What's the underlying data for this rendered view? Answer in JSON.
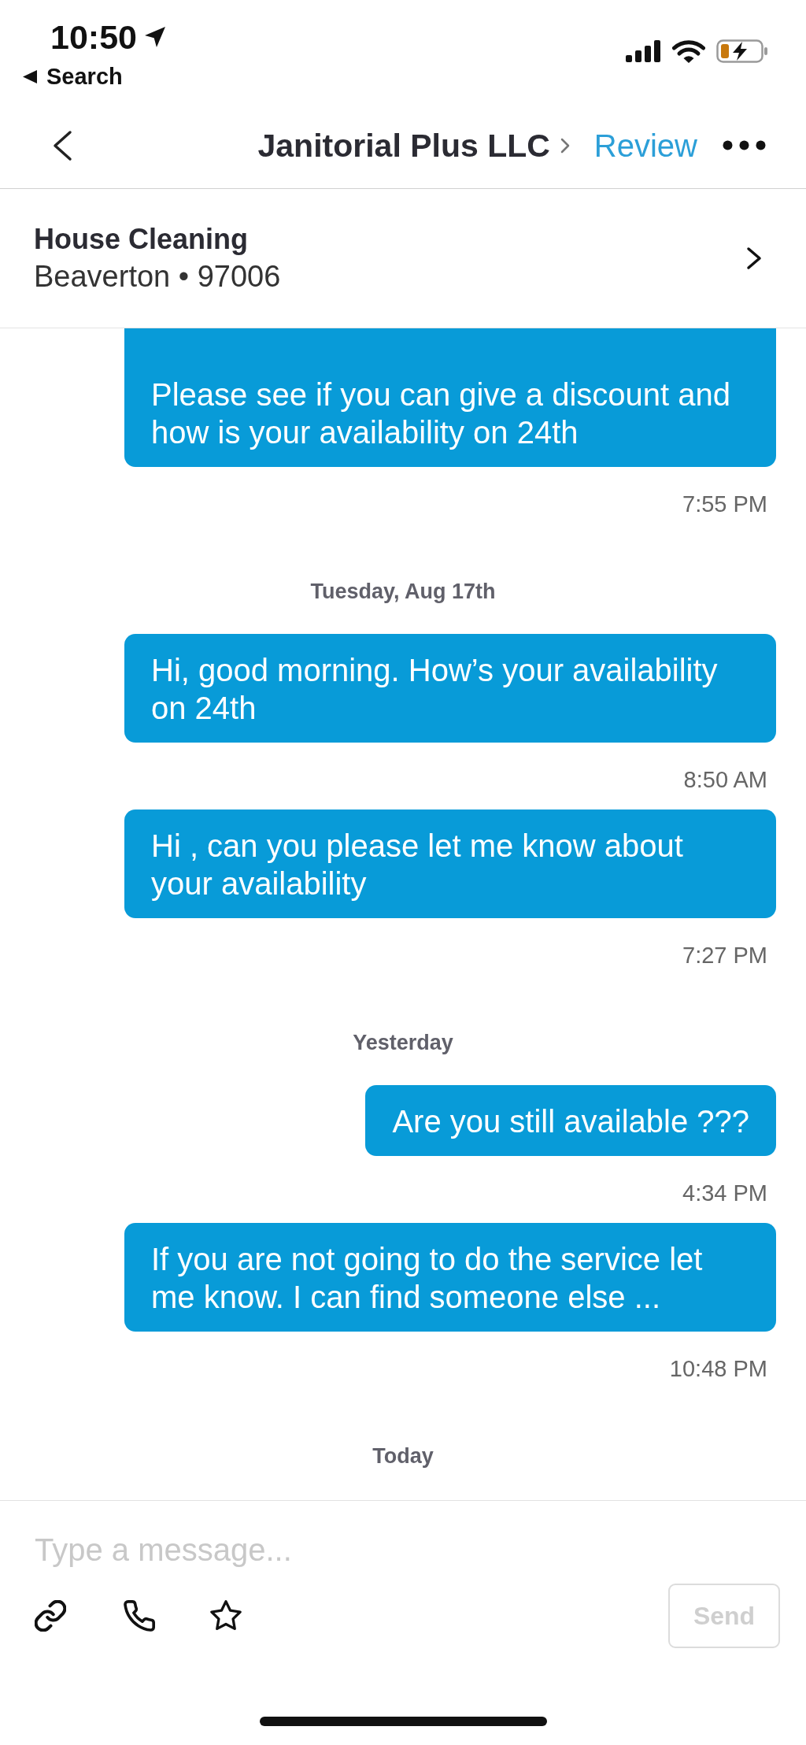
{
  "status_bar": {
    "time": "10:50",
    "back_link": "Search"
  },
  "nav_bar": {
    "title": "Janitorial Plus LLC",
    "action": "Review"
  },
  "job": {
    "title": "House Cleaning",
    "location": "Beaverton • 97006"
  },
  "days": [
    {
      "messages": [
        {
          "text": "Please see if you can give a discount and how is your availability on 24th",
          "time": "7:55 PM"
        }
      ]
    },
    {
      "date": "Tuesday, Aug 17th",
      "messages": [
        {
          "text": "Hi, good morning. How’s your availability on 24th",
          "time": "8:50 AM"
        },
        {
          "text": "Hi , can you please let me know about your availability",
          "time": "7:27 PM"
        }
      ]
    },
    {
      "date": "Yesterday",
      "messages": [
        {
          "text": "Are you still available ???",
          "time": "4:34 PM"
        },
        {
          "text": "If you are not going to do the service let me know. I can find someone else ...",
          "time": "10:48 PM"
        }
      ]
    },
    {
      "date": "Today"
    }
  ],
  "composer": {
    "placeholder": "Type a message...",
    "send": {
      "label": "Send",
      "disabled": true
    }
  }
}
